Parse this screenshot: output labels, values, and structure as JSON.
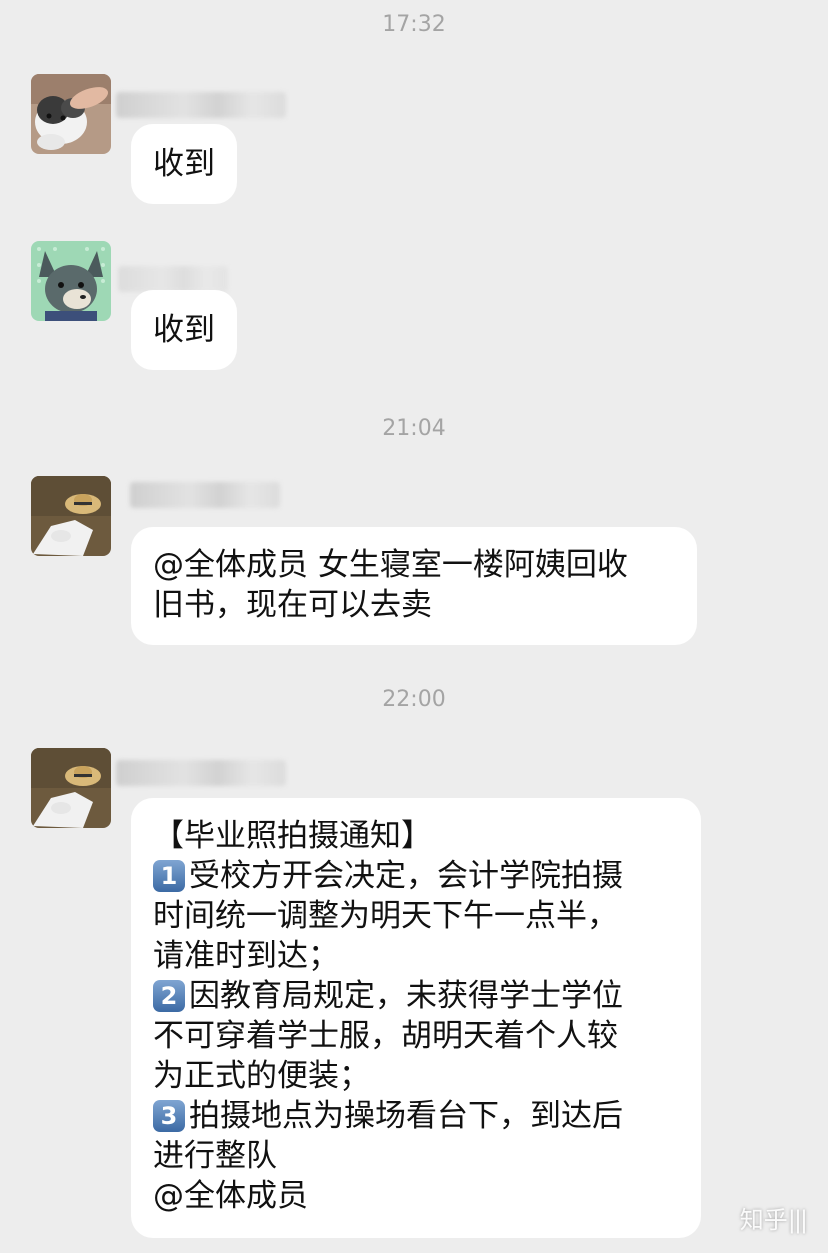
{
  "chat": {
    "timestamps": [
      "17:32",
      "21:04",
      "22:00"
    ],
    "messages": [
      {
        "text": "收到"
      },
      {
        "text": "收到"
      },
      {
        "lines": [
          "@全体成员 女生寝室一楼阿姨回收",
          "旧书，现在可以去卖"
        ]
      },
      {
        "lines": [
          {
            "text": "【毕业照拍摄通知】"
          },
          {
            "num": "1",
            "text": "受校方开会决定，会计学院拍摄"
          },
          {
            "text": "时间统一调整为明天下午一点半，"
          },
          {
            "text": "请准时到达；"
          },
          {
            "num": "2",
            "text": "因教育局规定，未获得学士学位"
          },
          {
            "text": "不可穿着学士服，胡明天着个人较"
          },
          {
            "text": "为正式的便装；"
          },
          {
            "num": "3",
            "text": "拍摄地点为操场看台下，到达后"
          },
          {
            "text": "进行整队"
          },
          {
            "text": "@全体成员"
          }
        ]
      }
    ]
  },
  "watermark": "知乎"
}
